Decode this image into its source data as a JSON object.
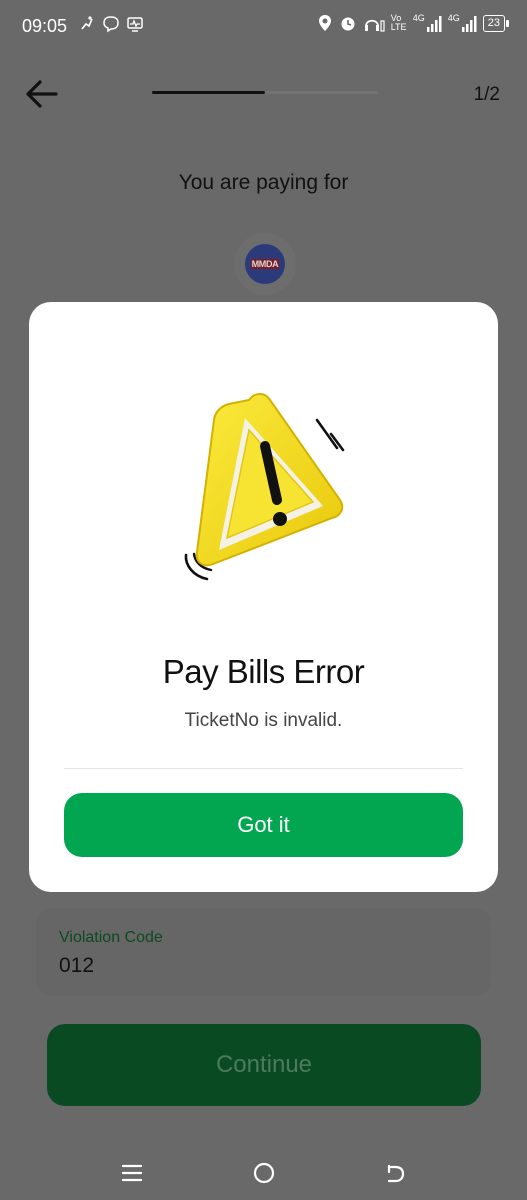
{
  "status_bar": {
    "time": "09:05",
    "battery": "23",
    "network_labels": [
      "Vo LTE",
      "4G",
      "4G"
    ]
  },
  "header": {
    "step_count": "1/2",
    "progress": 0.5,
    "paying_for": "You are paying for",
    "biller_logo_text": "MMDA"
  },
  "form": {
    "violation_code_label": "Violation Code",
    "violation_code_value": "012",
    "continue_label": "Continue"
  },
  "modal": {
    "title": "Pay Bills Error",
    "message": "TicketNo is invalid.",
    "button_label": "Got it"
  },
  "colors": {
    "accent": "#02a650",
    "overlay": "#696969",
    "warning": "#f6e22b"
  }
}
